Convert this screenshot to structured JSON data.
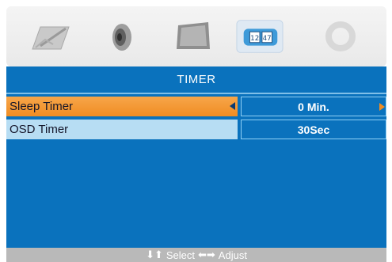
{
  "menu_icons": [
    {
      "name": "picture-icon",
      "selected": false
    },
    {
      "name": "sound-icon",
      "selected": false
    },
    {
      "name": "screen-icon",
      "selected": false
    },
    {
      "name": "timer-icon",
      "selected": true
    },
    {
      "name": "setup-icon",
      "selected": false
    }
  ],
  "osd": {
    "title": "TIMER",
    "rows": [
      {
        "label": "Sleep Timer",
        "value": "0 Min.",
        "highlighted": true
      },
      {
        "label": "OSD Timer",
        "value": "30Sec",
        "highlighted": false
      }
    ]
  },
  "footer": {
    "select_glyph": "⬇⬆",
    "select_label": "Select",
    "adjust_glyph": "⬅➡",
    "adjust_label": "Adjust"
  },
  "colors": {
    "panel_blue": "#0a72bd",
    "highlight_orange": "#f08d22",
    "row_light_blue": "#b7ddf3"
  }
}
